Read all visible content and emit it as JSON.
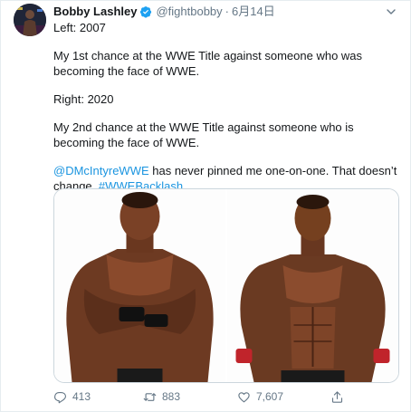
{
  "user": {
    "name": "Bobby Lashley",
    "handle": "@fightbobby",
    "separator": "·",
    "date": "6月14日"
  },
  "tweet": {
    "line1": "Left: 2007",
    "line2": "My 1st chance at the WWE Title against someone who was becoming the face of WWE.",
    "line3": "Right: 2020",
    "line4": "My 2nd chance at the WWE Title against someone who is becoming the face of WWE.",
    "mention": "@DMcIntyreWWE",
    "line5_text": " has never pinned me one-on-one. That doesn’t change. ",
    "hashtag": "#WWEBacklash"
  },
  "actions": {
    "replies": "413",
    "retweets": "883",
    "likes": "7,607"
  },
  "icons": {
    "verified": "verified-badge-icon",
    "menu": "chevron-down-icon",
    "reply": "reply-icon",
    "retweet": "retweet-icon",
    "like": "heart-icon",
    "share": "share-icon"
  },
  "colors": {
    "link": "#1b95e0",
    "secondary": "#657786",
    "verified": "#1da1f2"
  }
}
